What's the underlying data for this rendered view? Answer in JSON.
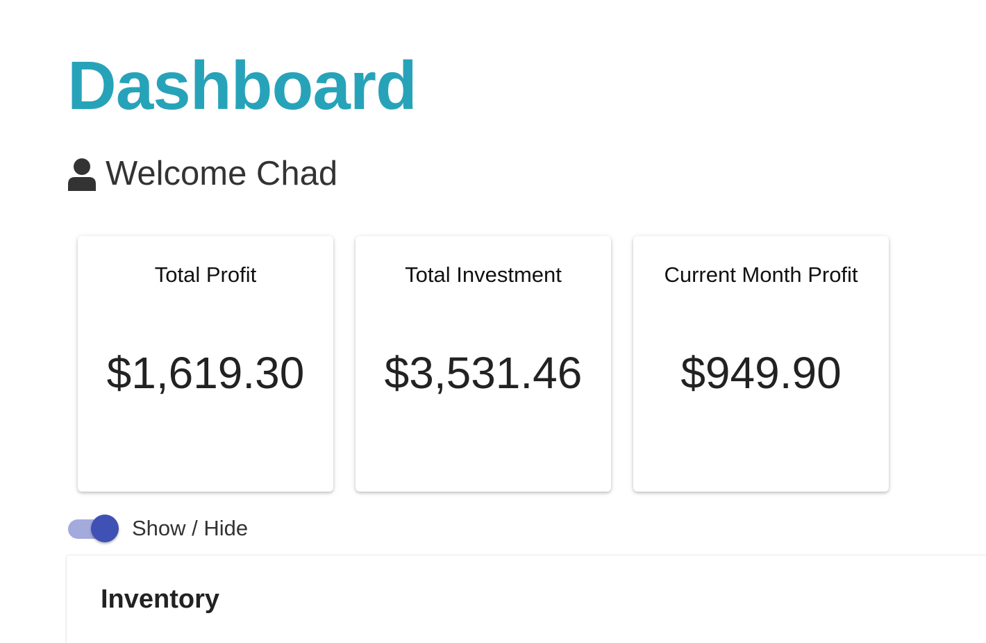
{
  "page": {
    "title": "Dashboard",
    "title_color": "#27a3b9"
  },
  "welcome": {
    "icon": "user-icon",
    "text": "Welcome Chad"
  },
  "cards": [
    {
      "label": "Total Profit",
      "value": "$1,619.30"
    },
    {
      "label": "Total Investment",
      "value": "$3,531.46"
    },
    {
      "label": "Current Month Profit",
      "value": "$949.90"
    }
  ],
  "toggle": {
    "label": "Show / Hide",
    "checked": true,
    "color": "#3f51b5"
  },
  "inventory": {
    "title": "Inventory"
  }
}
